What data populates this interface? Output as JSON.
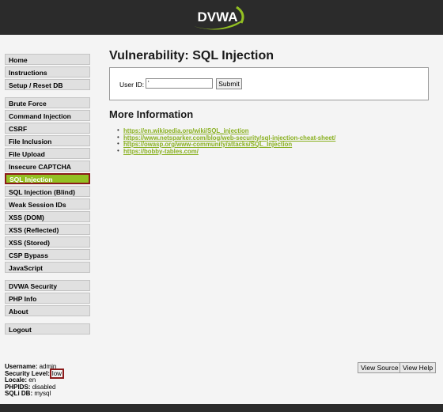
{
  "header": {
    "logo_text": "DVWA"
  },
  "sidebar": {
    "block1": [
      "Home",
      "Instructions",
      "Setup / Reset DB"
    ],
    "block2": [
      "Brute Force",
      "Command Injection",
      "CSRF",
      "File Inclusion",
      "File Upload",
      "Insecure CAPTCHA",
      "SQL Injection",
      "SQL Injection (Blind)",
      "Weak Session IDs",
      "XSS (DOM)",
      "XSS (Reflected)",
      "XSS (Stored)",
      "CSP Bypass",
      "JavaScript"
    ],
    "block3": [
      "DVWA Security",
      "PHP Info",
      "About"
    ],
    "block4": [
      "Logout"
    ],
    "selected": "SQL Injection"
  },
  "main": {
    "title": "Vulnerability: SQL Injection",
    "form": {
      "userid_label": "User ID:",
      "userid_value": "'",
      "submit_label": "Submit"
    },
    "more_info_heading": "More Information",
    "links": [
      "https://en.wikipedia.org/wiki/SQL_injection",
      "https://www.netsparker.com/blog/web-security/sql-injection-cheat-sheet/",
      "https://owasp.org/www-community/attacks/SQL_Injection",
      "https://bobby-tables.com/"
    ]
  },
  "status": {
    "username_label": "Username:",
    "username": "admin",
    "security_label": "Security Level:",
    "security": "low",
    "locale_label": "Locale:",
    "locale": "en",
    "phpids_label": "PHPIDS:",
    "phpids": "disabled",
    "sqlidb_label": "SQLi DB:",
    "sqlidb": "mysql"
  },
  "buttons": {
    "view_source": "View Source",
    "view_help": "View Help"
  },
  "colors": {
    "accent": "#93c022",
    "header": "#2b2b2b",
    "highlight": "#8b1a1a",
    "link": "#89b020"
  }
}
